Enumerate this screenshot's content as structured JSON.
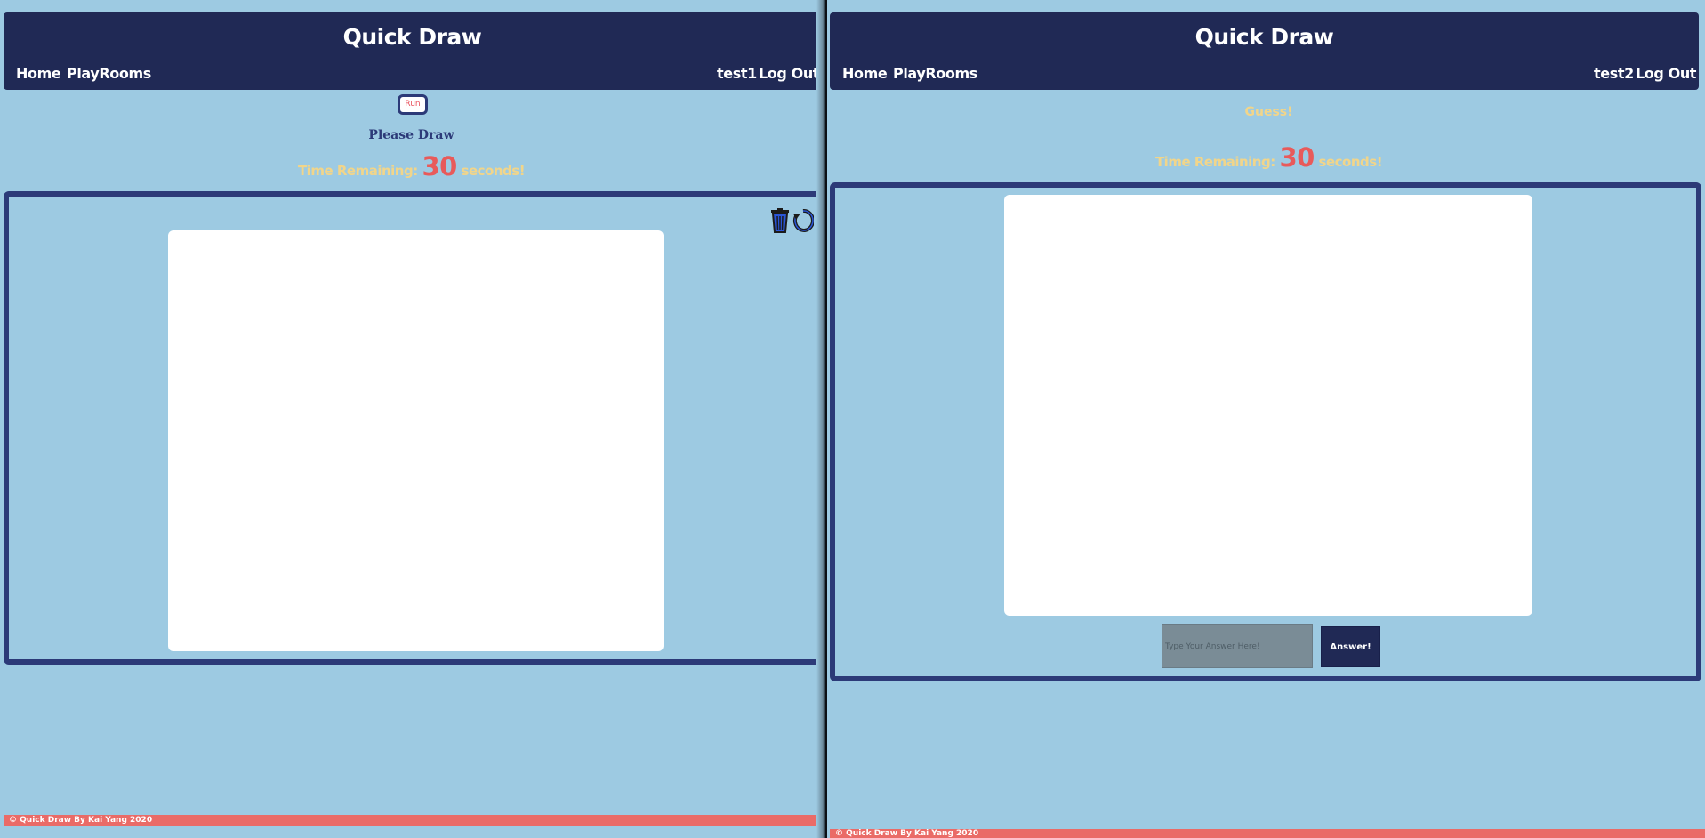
{
  "left": {
    "brand": "Quick Draw",
    "nav": {
      "home": "Home",
      "playrooms": "PlayRooms",
      "user": "test1",
      "logout": "Log Out"
    },
    "run_label": "Run",
    "instruction": "Please Draw",
    "timer": {
      "prefix": "Time Remaining:",
      "seconds": "30",
      "suffix": "seconds!"
    },
    "tools": [
      "trash-icon",
      "refresh-icon"
    ],
    "footer": "© Quick Draw By Kai Yang 2020"
  },
  "right": {
    "brand": "Quick Draw",
    "nav": {
      "home": "Home",
      "playrooms": "PlayRooms",
      "user": "test2",
      "logout": "Log Out"
    },
    "instruction": "Guess!",
    "timer": {
      "prefix": "Time Remaining:",
      "seconds": "30",
      "suffix": "seconds!"
    },
    "answer": {
      "placeholder": "Type Your Answer Here!",
      "value": "",
      "button": "Answer!"
    },
    "footer": "© Quick Draw By Kai Yang 2020"
  },
  "colors": {
    "background": "#9dcae2",
    "navbar": "#202955",
    "board_border": "#2c3a78",
    "timer_text": "#f1d58a",
    "timer_number": "#e85a5a",
    "footer": "#ea6b67"
  }
}
